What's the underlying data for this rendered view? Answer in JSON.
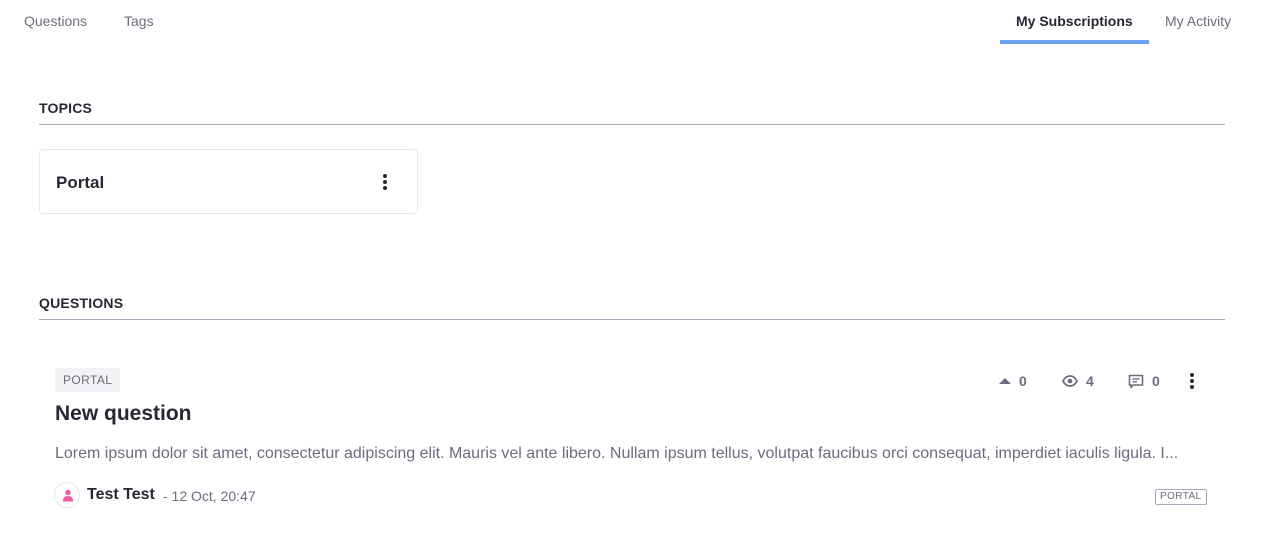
{
  "nav": {
    "left_tabs": [
      {
        "label": "Questions",
        "active": false
      },
      {
        "label": "Tags",
        "active": false
      }
    ],
    "right_tabs": [
      {
        "label": "My Subscriptions",
        "active": true
      },
      {
        "label": "My Activity",
        "active": false
      }
    ],
    "accent_color": "#6aa1f0"
  },
  "topics": {
    "title": "TOPICS",
    "items": [
      {
        "name": "Portal",
        "menu_icon": "ellipsis-vertical-icon"
      }
    ]
  },
  "questions": {
    "title": "QUESTIONS",
    "items": [
      {
        "tag": "PORTAL",
        "title": "New question",
        "body": "Lorem ipsum dolor sit amet, consectetur adipiscing elit. Mauris vel ante libero. Nullam ipsum tellus, volutpat faucibus orci consequat, imperdiet iaculis ligula. I...",
        "votes": "0",
        "views": "4",
        "answers": "0",
        "author": "Test Test",
        "date": "- 12 Oct, 20:47",
        "footer_tag": "PORTAL",
        "icons": {
          "votes": "caret-up-icon",
          "views": "eye-icon",
          "answers": "message-icon",
          "menu": "ellipsis-vertical-icon",
          "avatar": "user-icon"
        }
      }
    ]
  }
}
